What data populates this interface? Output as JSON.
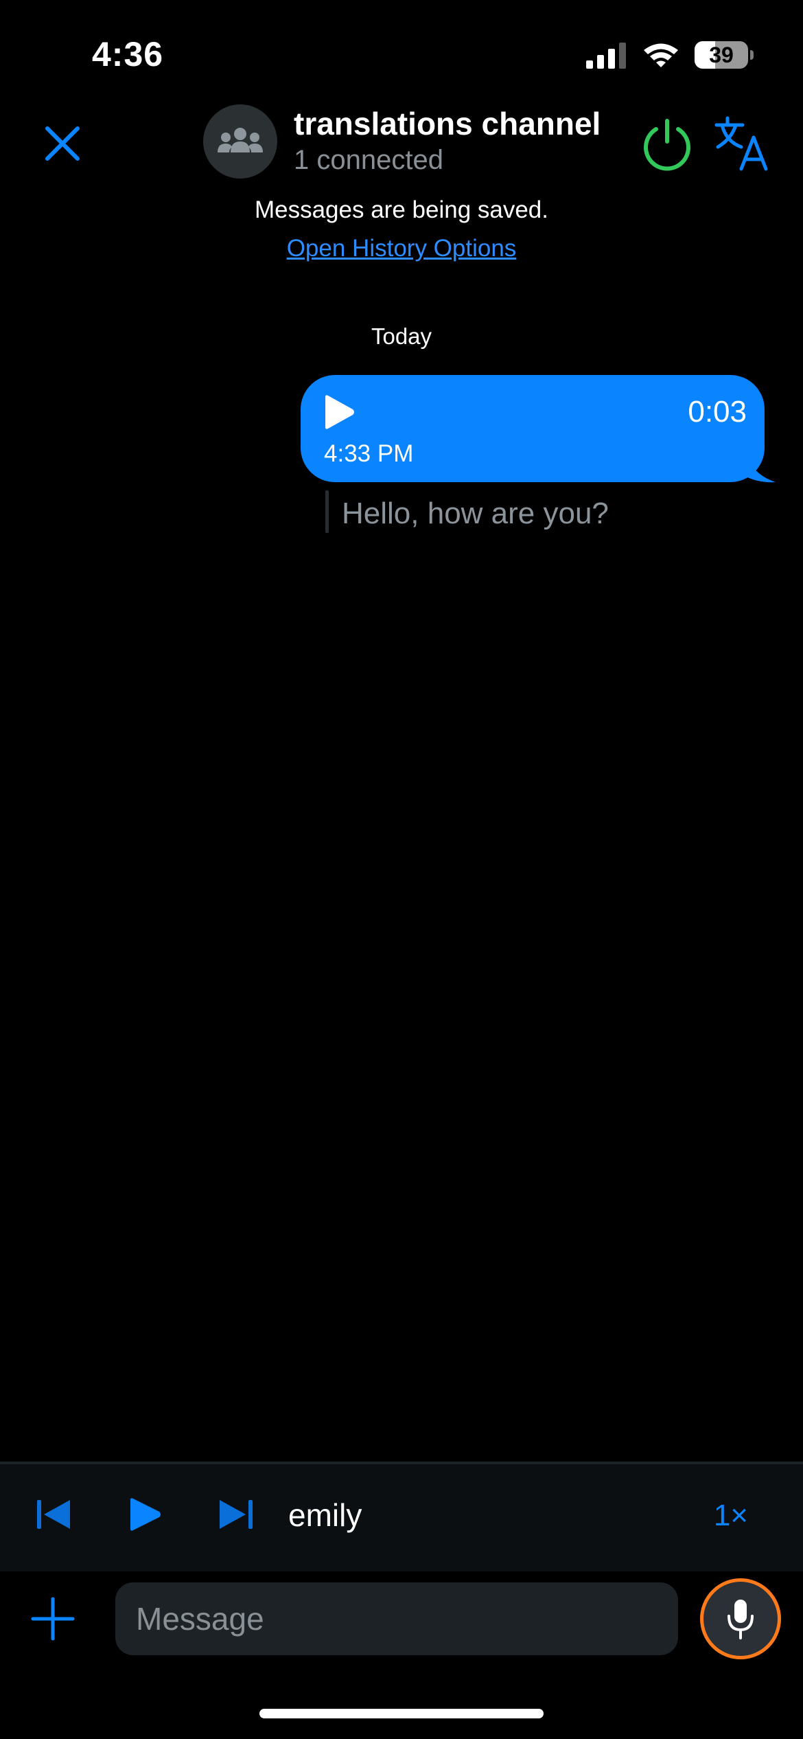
{
  "status_bar": {
    "time": "4:36",
    "battery_level": "39",
    "icons": [
      "cellular-signal-icon",
      "wifi-icon",
      "battery-icon"
    ]
  },
  "header": {
    "close_icon": "close-icon",
    "avatar_icon": "group-icon",
    "title": "translations channel",
    "subtitle": "1 connected",
    "power_icon": "power-icon",
    "translate_icon": "translate-icon"
  },
  "notice": {
    "text": "Messages are being saved.",
    "link": "Open History Options"
  },
  "conversation": {
    "date_separator": "Today",
    "messages": [
      {
        "type": "voice",
        "duration": "0:03",
        "time": "4:33 PM",
        "transcript": "Hello, how are you?"
      }
    ]
  },
  "player": {
    "speaker": "emily",
    "speed": "1×"
  },
  "composer": {
    "placeholder": "Message",
    "value": ""
  },
  "colors": {
    "background": "#000000",
    "accent": "#0a84ff",
    "bubble": "#0a84ff",
    "power_green": "#32c85a",
    "mic_ring": "#ff7a1a",
    "muted_text": "#8a9196"
  }
}
